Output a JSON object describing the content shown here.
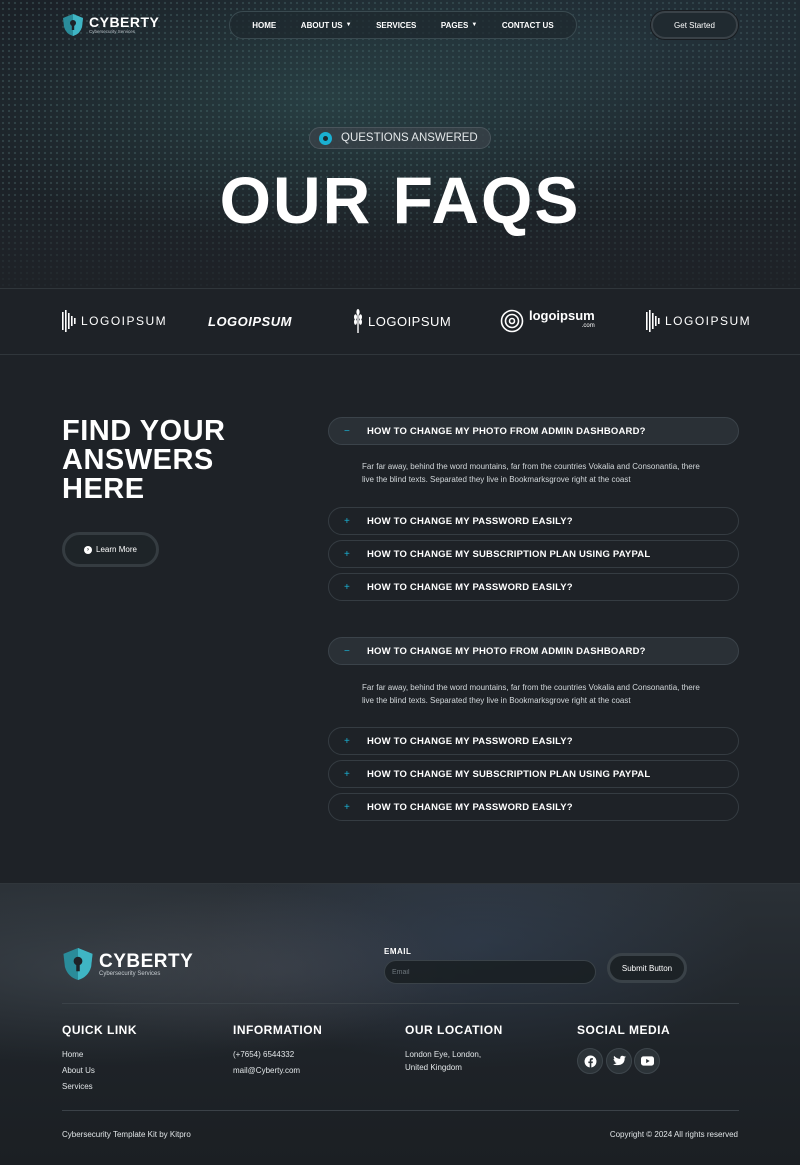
{
  "colors": {
    "accent": "#1ab0d2",
    "background": "#1e2227",
    "border": "#353c42"
  },
  "header": {
    "logo_name": "CYBERTY",
    "logo_tagline": "Cybersecurity Services",
    "nav": [
      {
        "label": "HOME",
        "has_dropdown": false
      },
      {
        "label": "ABOUT US",
        "has_dropdown": true
      },
      {
        "label": "SERVICES",
        "has_dropdown": false
      },
      {
        "label": "PAGES",
        "has_dropdown": true
      },
      {
        "label": "CONTACT US",
        "has_dropdown": false
      }
    ],
    "cta_label": "Get Started"
  },
  "hero": {
    "badge": "QUESTIONS ANSWERED",
    "title": "OUR FAQS"
  },
  "logos": [
    {
      "text": "LOGOIPSUM",
      "icon": "bars-logo-icon"
    },
    {
      "text": "LOGOIPSUM",
      "icon": "none"
    },
    {
      "text": "LOGOIPSUM",
      "icon": "wheat-logo-icon"
    },
    {
      "text": "logoipsum",
      "sub": ".com",
      "icon": "spiral-logo-icon"
    },
    {
      "text": "LOGOIPSUM",
      "icon": "bars-logo-icon"
    }
  ],
  "faq": {
    "heading": "FIND YOUR ANSWERS HERE",
    "learn_more": "Learn More",
    "groups": [
      {
        "items": [
          {
            "sign": "−",
            "question": "HOW TO CHANGE MY PHOTO FROM ADMIN DASHBOARD?",
            "open": true,
            "answer": "Far far away, behind the word mountains, far from the countries Vokalia and Consonantia, there live the blind texts. Separated they live in Bookmarksgrove right at the coast"
          },
          {
            "sign": "+",
            "question": "HOW TO CHANGE MY PASSWORD EASILY?"
          },
          {
            "sign": "+",
            "question": "HOW TO CHANGE MY SUBSCRIPTION PLAN USING PAYPAL"
          },
          {
            "sign": "+",
            "question": "HOW TO CHANGE MY PASSWORD EASILY?"
          }
        ]
      },
      {
        "items": [
          {
            "sign": "−",
            "question": "HOW TO CHANGE MY PHOTO FROM ADMIN DASHBOARD?",
            "open": true,
            "answer": "Far far away, behind the word mountains, far from the countries Vokalia and Consonantia, there live the blind texts. Separated they live in Bookmarksgrove right at the coast"
          },
          {
            "sign": "+",
            "question": "HOW TO CHANGE MY PASSWORD EASILY?"
          },
          {
            "sign": "+",
            "question": "HOW TO CHANGE MY SUBSCRIPTION PLAN USING PAYPAL"
          },
          {
            "sign": "+",
            "question": "HOW TO CHANGE MY PASSWORD EASILY?"
          }
        ]
      }
    ]
  },
  "footer": {
    "logo_name": "CYBERTY",
    "logo_tagline": "Cybersecurity Services",
    "email_label": "EMAIL",
    "email_placeholder": "Email",
    "submit_label": "Submit Button",
    "quick_link": {
      "title": "QUICK LINK",
      "links": [
        "Home",
        "About Us",
        "Services"
      ]
    },
    "information": {
      "title": "INFORMATION",
      "lines": [
        "(+7654) 6544332",
        "mail@Cyberty.com"
      ]
    },
    "location": {
      "title": "OUR LOCATION",
      "lines": [
        "London Eye, London,",
        "United Kingdom"
      ]
    },
    "social": {
      "title": "SOCIAL MEDIA",
      "icons": [
        "facebook-icon",
        "twitter-icon",
        "youtube-icon"
      ]
    },
    "credit": "Cybersecurity Template Kit by Kitpro",
    "copyright": "Copyright © 2024 All rights reserved"
  }
}
